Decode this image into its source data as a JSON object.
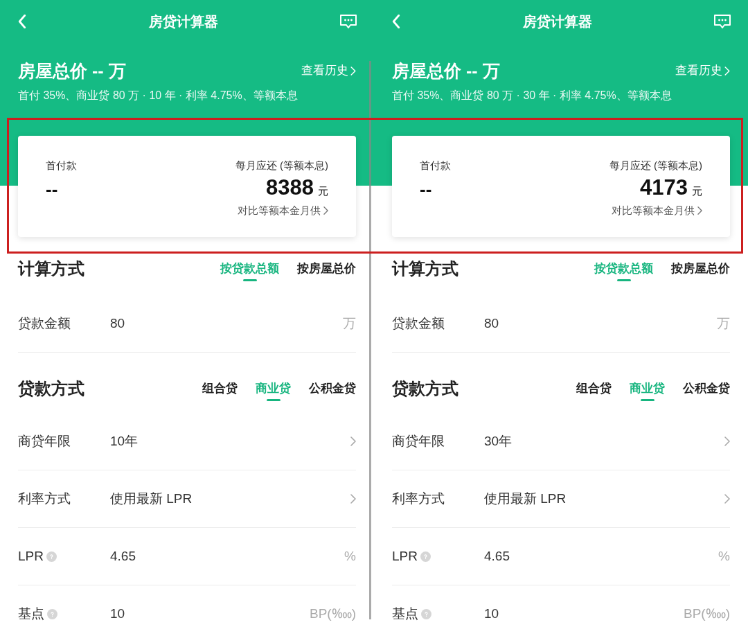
{
  "screens": [
    {
      "title": "房贷计算器",
      "header": {
        "price": "房屋总价 -- 万",
        "history_link": "查看历史",
        "summary": "首付 35%、商业贷 80 万 · 10 年 · 利率 4.75%、等额本息"
      },
      "card": {
        "down_label": "首付款",
        "down_value": "--",
        "monthly_label": "每月应还 (等额本息)",
        "monthly_value": "8388",
        "monthly_unit": "元",
        "compare_link": "对比等额本金月供"
      },
      "calc_method": {
        "title": "计算方式",
        "options": [
          {
            "label": "按贷款总额",
            "selected": true
          },
          {
            "label": "按房屋总价",
            "selected": false
          }
        ]
      },
      "amount_row": {
        "label": "贷款金额",
        "value": "80",
        "unit": "万"
      },
      "loan_type": {
        "title": "贷款方式",
        "options": [
          {
            "label": "组合贷",
            "selected": false
          },
          {
            "label": "商业贷",
            "selected": true
          },
          {
            "label": "公积金贷",
            "selected": false
          }
        ]
      },
      "rows": [
        {
          "kind": "select",
          "label": "商贷年限",
          "value": "10年"
        },
        {
          "kind": "select",
          "label": "利率方式",
          "value": "使用最新 LPR"
        },
        {
          "kind": "input",
          "label": "LPR",
          "help": true,
          "value": "4.65",
          "unit": "%"
        },
        {
          "kind": "input",
          "label": "基点",
          "help": true,
          "value": "10",
          "unit": "BP(‱)"
        }
      ]
    },
    {
      "title": "房贷计算器",
      "header": {
        "price": "房屋总价 -- 万",
        "history_link": "查看历史",
        "summary": "首付 35%、商业贷 80 万 · 30 年 · 利率 4.75%、等额本息"
      },
      "card": {
        "down_label": "首付款",
        "down_value": "--",
        "monthly_label": "每月应还 (等额本息)",
        "monthly_value": "4173",
        "monthly_unit": "元",
        "compare_link": "对比等额本金月供"
      },
      "calc_method": {
        "title": "计算方式",
        "options": [
          {
            "label": "按贷款总额",
            "selected": true
          },
          {
            "label": "按房屋总价",
            "selected": false
          }
        ]
      },
      "amount_row": {
        "label": "贷款金额",
        "value": "80",
        "unit": "万"
      },
      "loan_type": {
        "title": "贷款方式",
        "options": [
          {
            "label": "组合贷",
            "selected": false
          },
          {
            "label": "商业贷",
            "selected": true
          },
          {
            "label": "公积金贷",
            "selected": false
          }
        ]
      },
      "rows": [
        {
          "kind": "select",
          "label": "商贷年限",
          "value": "30年"
        },
        {
          "kind": "select",
          "label": "利率方式",
          "value": "使用最新 LPR"
        },
        {
          "kind": "input",
          "label": "LPR",
          "help": true,
          "value": "4.65",
          "unit": "%"
        },
        {
          "kind": "input",
          "label": "基点",
          "help": true,
          "value": "10",
          "unit": "BP(‱)"
        }
      ]
    }
  ]
}
